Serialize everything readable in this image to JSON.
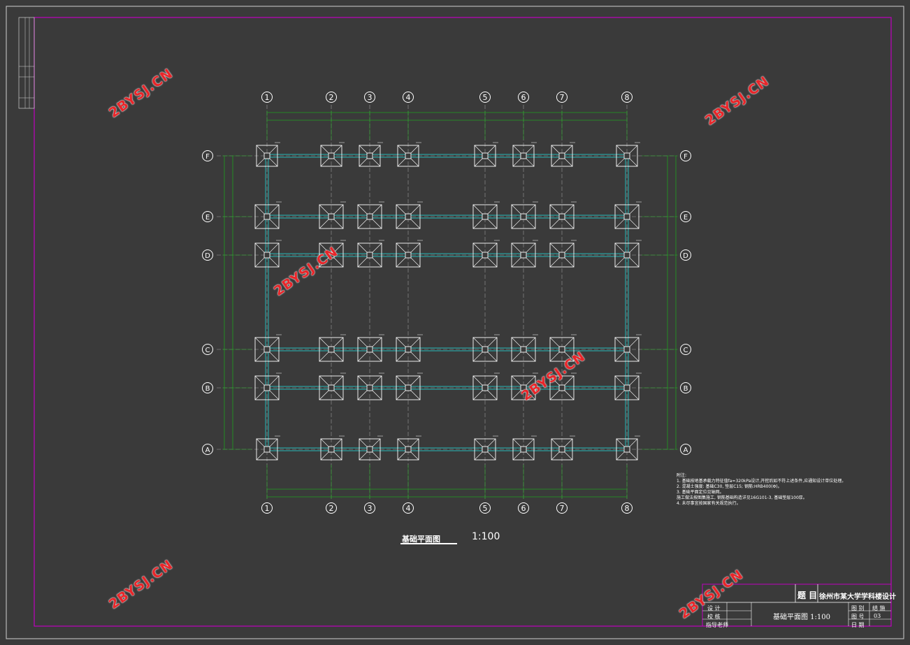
{
  "drawing": {
    "plan_title": "基础平面图",
    "plan_scale": "1:100",
    "background": "#3a3a3a",
    "colors": {
      "frame": "#c000c0",
      "axis_circle": "#ffffff",
      "dimension": "#1fa11f",
      "beam": "#25b8b8",
      "footing": "#ffffff",
      "axis_line": "#9a9a9a",
      "watermark": "#e8262a"
    }
  },
  "axes": {
    "columns": [
      "1",
      "2",
      "3",
      "4",
      "5",
      "6",
      "7",
      "8"
    ],
    "rows": [
      "F",
      "E",
      "D",
      "C",
      "B",
      "A"
    ]
  },
  "notes": {
    "heading": "附注:",
    "lines": [
      "1. 基础按地基承载力特征值fa=320kPa设计,开挖后如不符上述条件,应通知设计单位处理。",
      "2. 混凝土强度: 基础C30, 垫层C15; 钢筋:HRB400(Φ)。",
      "3. 基础平面定位见轴网。",
      "   施工做法按图集施工, 钢筋基础构造详见16G101-3, 基础垫层100厚。",
      "4. 未尽事宜按国家有关规范执行。"
    ]
  },
  "title_block": {
    "subject_label": "题 目",
    "subject": "徐州市某大学学科楼设计",
    "drawing_name": "基础平面图 1:100",
    "row_labels": [
      "设 计",
      "校 核",
      "指导老师"
    ],
    "right_labels": [
      "图 别",
      "图 号",
      "日 期"
    ],
    "right_values": [
      "结 施",
      "03",
      ""
    ]
  },
  "watermark": {
    "text": "2BYSJ.CN"
  },
  "sidebar": {
    "labels": [
      "审 定",
      "审 核",
      "设 计"
    ]
  }
}
